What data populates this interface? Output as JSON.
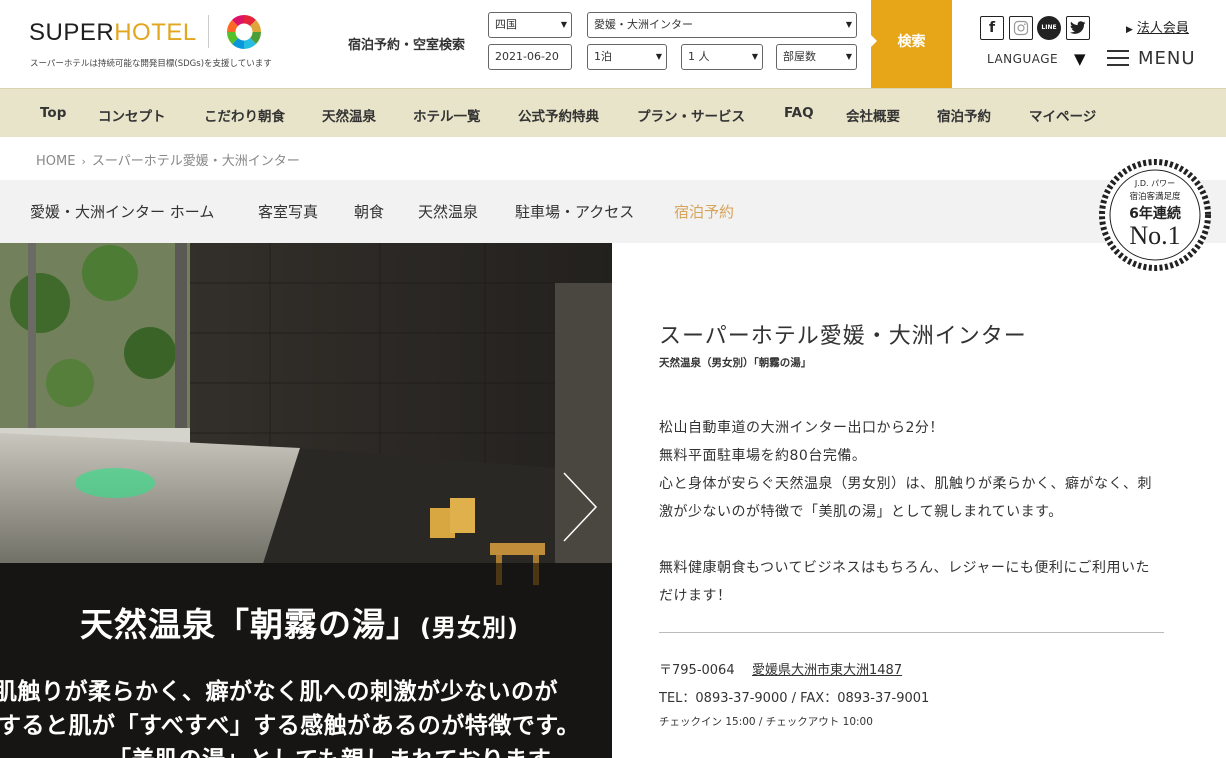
{
  "header": {
    "logo_part1": "SUPER",
    "logo_part2": "HOTEL",
    "logo_tagline": "スーパーホテルは持続可能な開発目標(SDGs)を支援しています",
    "search_label": "宿泊予約・空室検索",
    "search": {
      "region": "四国",
      "hotel": "愛媛・大洲インター",
      "date": "2021-06-20",
      "nights": "1泊",
      "guests": "1 人",
      "rooms": "部屋数"
    },
    "search_button": "検索",
    "corporate_link": "法人会員",
    "language_label": "LANGUAGE",
    "menu_label": "MENU"
  },
  "global_nav": [
    "Top",
    "コンセプト",
    "こだわり朝食",
    "天然温泉",
    "ホテル一覧",
    "公式予約特典",
    "プラン・サービス",
    "FAQ",
    "会社概要",
    "宿泊予約",
    "マイページ"
  ],
  "breadcrumb": {
    "home": "HOME",
    "current": "スーパーホテル愛媛・大洲インター"
  },
  "local_nav": [
    "愛媛・大洲インター ホーム",
    "客室写真",
    "朝食",
    "天然温泉",
    "駐車場・アクセス",
    "宿泊予約"
  ],
  "award": {
    "line1": "J.D. パワー",
    "line2": "宿泊客満足度",
    "line3": "6年連続",
    "line4": "No.1"
  },
  "hero": {
    "caption_title": "天然温泉「朝霧の湯」",
    "caption_title_suffix": "(男女別)",
    "caption_line1": "肌触りが柔らかく、癖がなく肌への刺激が少ないのが",
    "caption_line2": "すると肌が「すべすべ」する感触があるのが特徴です。",
    "caption_line3": "「美肌の湯」としても親しまれております。"
  },
  "hotel": {
    "title": "スーパーホテル愛媛・大洲インター",
    "subtitle": "天然温泉（男女別）「朝霧の湯」",
    "desc_p1": "松山自動車道の大洲インター出口から2分！\n無料平面駐車場を約80台完備。\n心と身体が安らぐ天然温泉（男女別）は、肌触りが柔らかく、癖がなく、刺激が少ないのが特徴で「美肌の湯」として親しまれています。",
    "desc_p2": "無料健康朝食もついてビジネスはもちろん、レジャーにも便利にご利用いただけます！",
    "postal": "〒795-0064",
    "address": "愛媛県大洲市東大洲1487",
    "tel": "TEL：0893-37-9000 / FAX：0893-37-9001",
    "checkin": "チェックイン 15:00 / チェックアウト 10:00"
  },
  "colors": {
    "brand_gold": "#e6a617",
    "nav_bg": "#e8e4c9",
    "local_nav_active": "#d7a45a"
  }
}
